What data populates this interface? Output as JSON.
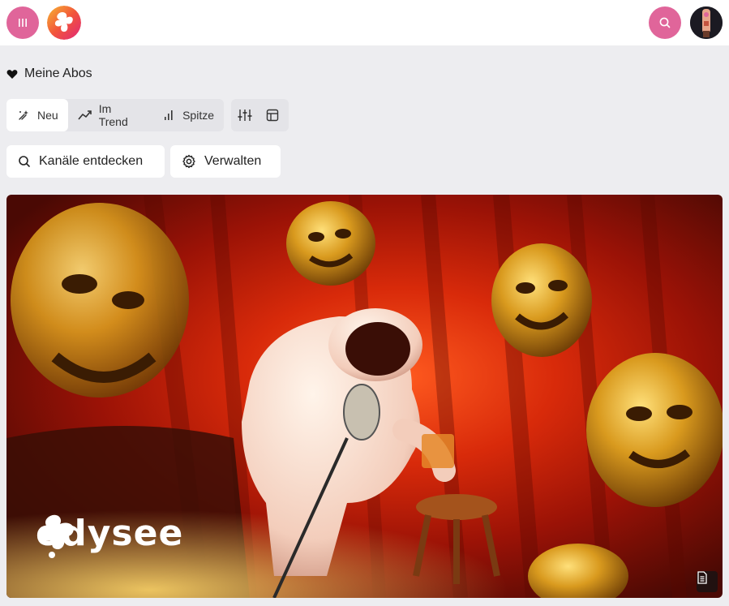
{
  "header": {
    "menu_icon": "menu-icon",
    "logo_icon": "odysee-logo-icon",
    "search_icon": "search-icon",
    "avatar_icon": "user-avatar-icon",
    "accent_color": "#e0659a"
  },
  "section": {
    "title": "Meine Abos",
    "icon": "heart-icon"
  },
  "sort_tabs": [
    {
      "label": "Neu",
      "icon": "sparkle-icon",
      "active": true
    },
    {
      "label": "Im Trend",
      "icon": "trending-up-icon",
      "active": false
    },
    {
      "label": "Spitze",
      "icon": "bar-chart-icon",
      "active": false
    }
  ],
  "view_tools": [
    {
      "icon": "sliders-icon"
    },
    {
      "icon": "layout-icon"
    }
  ],
  "actions": {
    "discover": {
      "label": "Kanäle entdecken",
      "icon": "search-icon"
    },
    "manage": {
      "label": "Verwalten",
      "icon": "gear-icon"
    }
  },
  "banner": {
    "brand": "odysee",
    "icon": "document-icon"
  }
}
